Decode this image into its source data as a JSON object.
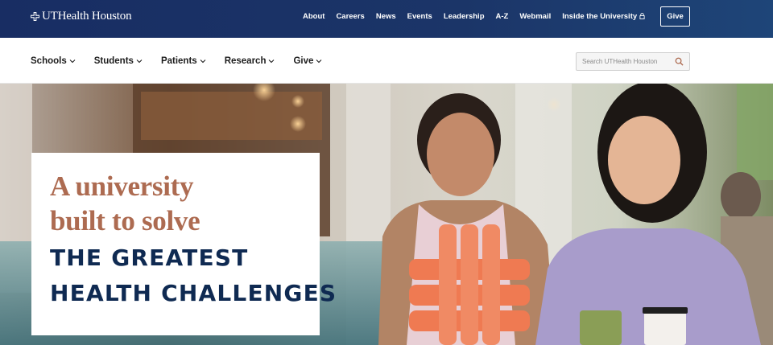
{
  "brand": {
    "logo_text": "UTHealth Houston",
    "colors": {
      "navy": "#182d63",
      "copper": "#ad6b51",
      "headline_navy": "#0f2a52",
      "sign_orange": "#ef7a52"
    }
  },
  "utility_nav": {
    "links": [
      "About",
      "Careers",
      "News",
      "Events",
      "Leadership",
      "A-Z",
      "Webmail",
      "Inside the University"
    ],
    "inside_icon": "lock-icon",
    "give_label": "Give"
  },
  "main_nav": {
    "items": [
      "Schools",
      "Students",
      "Patients",
      "Research",
      "Give"
    ],
    "item_icon": "chevron-down-icon"
  },
  "search": {
    "placeholder": "Search UTHealth Houston",
    "icon": "search-icon"
  },
  "hero": {
    "line1": "A university",
    "line2": "built to solve",
    "line3": "THE GREATEST",
    "line4": "HEALTH CHALLENGES"
  }
}
